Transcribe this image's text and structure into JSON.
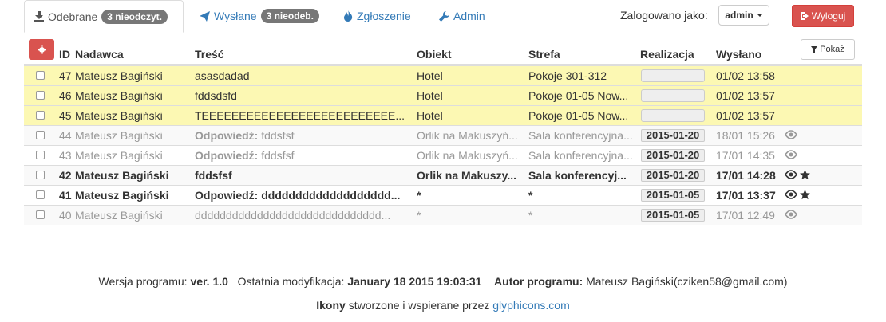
{
  "tabs": [
    {
      "label": "Odebrane",
      "badge": "3 nieodczyt."
    },
    {
      "label": "Wysłane",
      "badge": "3 nieodeb."
    },
    {
      "label": "Zgłoszenie"
    },
    {
      "label": "Admin"
    }
  ],
  "user": {
    "label": "Zalogowano jako:",
    "name": "admin"
  },
  "logout_label": "Wyloguj",
  "show_label": "Pokaż",
  "columns": [
    "ID",
    "Nadawca",
    "Treść",
    "Obiekt",
    "Strefa",
    "Realizacja",
    "Wysłano"
  ],
  "rows": [
    {
      "id": "47",
      "sender": "Mateusz Bagiński",
      "prefix": "",
      "content": "asasdadad",
      "object": "Hotel",
      "zone": "Pokoje 301-312",
      "realization": "",
      "sent": "01/02 13:58",
      "style": "new",
      "eye": false,
      "star": false
    },
    {
      "id": "46",
      "sender": "Mateusz Bagiński",
      "prefix": "",
      "content": "fddsdsfd",
      "object": "Hotel",
      "zone": "Pokoje 01-05 Now...",
      "realization": "",
      "sent": "01/02 13:57",
      "style": "new",
      "eye": false,
      "star": false
    },
    {
      "id": "45",
      "sender": "Mateusz Bagiński",
      "prefix": "",
      "content": "TEEEEEEEEEEEEEEEEEEEEEEEEEE...",
      "object": "Hotel",
      "zone": "Pokoje 01-05 Now...",
      "realization": "",
      "sent": "01/02 13:57",
      "style": "new",
      "eye": false,
      "star": false
    },
    {
      "id": "44",
      "sender": "Mateusz Bagiński",
      "prefix": "Odpowiedź:",
      "content": "fddsfsf",
      "object": "Orlik na Makuszyń...",
      "zone": "Sala konferencyjna...",
      "realization": "2015-01-20",
      "sent": "18/01 15:26",
      "style": "grey",
      "eye": true,
      "star": false
    },
    {
      "id": "43",
      "sender": "Mateusz Bagiński",
      "prefix": "Odpowiedź:",
      "content": "fddsfsf",
      "object": "Orlik na Makuszyń...",
      "zone": "Sala konferencyjna...",
      "realization": "2015-01-20",
      "sent": "17/01 14:35",
      "style": "grey",
      "eye": true,
      "star": false
    },
    {
      "id": "42",
      "sender": "Mateusz Bagiński",
      "prefix": "",
      "content": "fddsfsf",
      "object": "Orlik na Makuszy...",
      "zone": "Sala konferencyj...",
      "realization": "2015-01-20",
      "sent": "17/01 14:28",
      "style": "bold",
      "eye": true,
      "star": true
    },
    {
      "id": "41",
      "sender": "Mateusz Bagiński",
      "prefix": "",
      "content": "Odpowiedź: ddddddddddddddddddd...",
      "object": "*",
      "zone": "*",
      "realization": "2015-01-05",
      "sent": "17/01 13:37",
      "style": "bold",
      "eye": true,
      "star": true
    },
    {
      "id": "40",
      "sender": "Mateusz Bagiński",
      "prefix": "",
      "content": "dddddddddddddddddddddddddddddd...",
      "object": "*",
      "zone": "*",
      "realization": "2015-01-05",
      "sent": "17/01 12:49",
      "style": "grey",
      "eye": true,
      "star": false
    }
  ],
  "footer": {
    "version_label": "Wersja programu:",
    "version": "ver. 1.0",
    "modified_label": "Ostatnia modyfikacja:",
    "modified": "January 18 2015 19:03:31",
    "author_label": "Autor programu:",
    "author": "Mateusz Bagiński(cziken58@gmail.com)",
    "icons_label": "Ikony",
    "icons_text": "stworzone i wspierane przez",
    "icons_link": "glyphicons.com"
  }
}
